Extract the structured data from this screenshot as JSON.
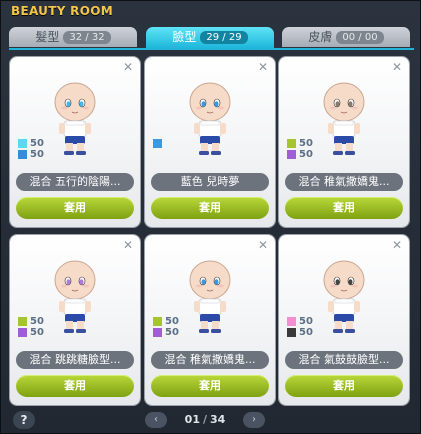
{
  "window": {
    "title": "BEAUTY ROOM"
  },
  "tabs": [
    {
      "label": "髮型",
      "count": "32 / 32",
      "active": false
    },
    {
      "label": "臉型",
      "count": "29 / 29",
      "active": true
    },
    {
      "label": "皮膚",
      "count": "00 / 00",
      "active": false
    }
  ],
  "cards": [
    {
      "name": "混合 五行的陰陽...",
      "button": "套用",
      "swatches": [
        {
          "color": "#5fd6f2",
          "value": "50"
        },
        {
          "color": "#3a8ad8",
          "value": "50"
        }
      ],
      "eyes": "#45b4e6"
    },
    {
      "name": "藍色 兒時夢",
      "button": "套用",
      "swatches": [
        {
          "color": "#3a9ae0",
          "value": ""
        }
      ],
      "eyes": "#3a9ae0"
    },
    {
      "name": "混合 稚氣撒嬌鬼...",
      "button": "套用",
      "swatches": [
        {
          "color": "#a5c52e",
          "value": "50"
        },
        {
          "color": "#a05ed6",
          "value": "50"
        }
      ],
      "eyes": "#8a7a6a"
    },
    {
      "name": "混合 跳跳糖臉型...",
      "button": "套用",
      "swatches": [
        {
          "color": "#a5c52e",
          "value": "50"
        },
        {
          "color": "#a05ed6",
          "value": "50"
        }
      ],
      "eyes": "#b07ad8"
    },
    {
      "name": "混合 稚氣撒嬌鬼...",
      "button": "套用",
      "swatches": [
        {
          "color": "#a5c52e",
          "value": "50"
        },
        {
          "color": "#a05ed6",
          "value": "50"
        }
      ],
      "eyes": "#3a9ae0"
    },
    {
      "name": "混合 氣鼓鼓臉型...",
      "button": "套用",
      "swatches": [
        {
          "color": "#f28fd0",
          "value": "50"
        },
        {
          "color": "#3a3a3a",
          "value": "50"
        }
      ],
      "eyes": "#444444"
    }
  ],
  "footer": {
    "help": "?",
    "page_current": "01",
    "page_separator": "/",
    "page_total": "34",
    "prev": "‹",
    "next": "›"
  },
  "icons": {
    "close": "close-icon"
  }
}
